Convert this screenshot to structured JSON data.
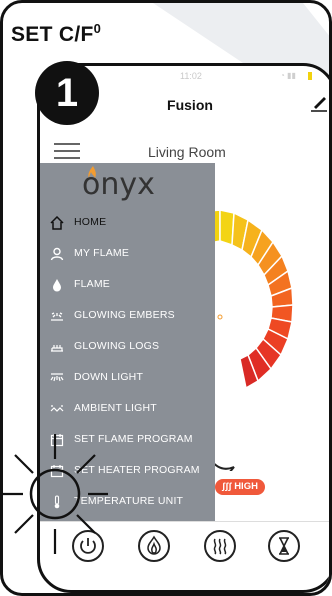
{
  "heading": {
    "text": "SET C/F",
    "superscript": "0"
  },
  "step_number": "1",
  "phone": {
    "status_time": "11:02",
    "app_title": "Fusion",
    "room_name": "Living Room"
  },
  "drawer": {
    "brand": "onyx",
    "items": [
      {
        "label": "HOME",
        "icon": "home-icon",
        "active": true
      },
      {
        "label": "MY FLAME",
        "icon": "person-icon"
      },
      {
        "label": "FLAME",
        "icon": "flame-drop-icon"
      },
      {
        "label": "GLOWING EMBERS",
        "icon": "embers-icon"
      },
      {
        "label": "GLOWING LOGS",
        "icon": "logs-icon"
      },
      {
        "label": "DOWN LIGHT",
        "icon": "down-light-icon"
      },
      {
        "label": "AMBIENT LIGHT",
        "icon": "ambient-light-icon"
      },
      {
        "label": "SET FLAME PROGRAM",
        "icon": "calendar-icon"
      },
      {
        "label": "SET HEATER PROGRAM",
        "icon": "calendar-icon"
      },
      {
        "label": "TEMPERATURE UNIT",
        "icon": "thermometer-icon"
      }
    ]
  },
  "badge": {
    "label": "HIGH"
  },
  "bottom_bar": [
    "power-icon",
    "flame-icon",
    "heat-icon",
    "timer-icon"
  ],
  "colors": {
    "drawer_bg": "#8a8f96",
    "accent": "#f0593b",
    "yellow": "#f2d20e"
  }
}
